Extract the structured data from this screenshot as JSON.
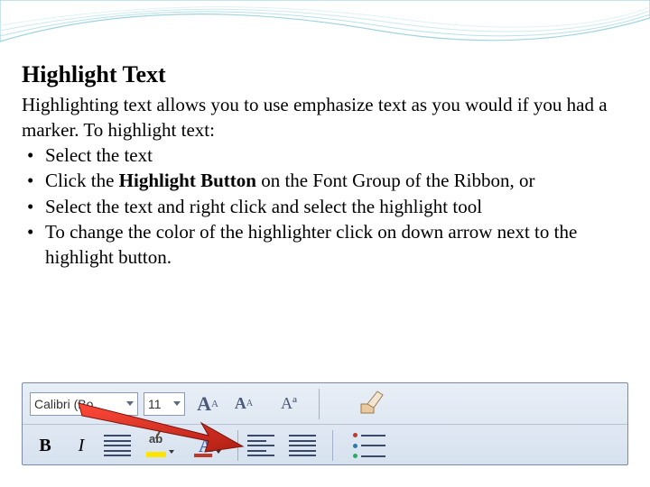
{
  "title": "Highlight Text",
  "intro": "Highlighting text allows you to use emphasize text as you would if you had a marker.  To highlight text:",
  "bullets": [
    {
      "text": "Select the text"
    },
    {
      "prefix": "Click the ",
      "bold": "Highlight Button",
      "suffix": " on the Font Group of the Ribbon, or"
    },
    {
      "text": "Select the text and right click and select the highlight tool"
    },
    {
      "text": "To change the color of the highlighter click on down arrow next to the highlight button."
    }
  ],
  "ribbon": {
    "font_name": "Calibri (Bo",
    "font_size": "11",
    "grow_a_big": "A",
    "grow_a_small": "A",
    "shrink_a_big": "A",
    "shrink_a_small": "A",
    "bold_label": "B",
    "italic_label": "I",
    "highlight_ab": "ab",
    "fontcolor_a": "A"
  }
}
